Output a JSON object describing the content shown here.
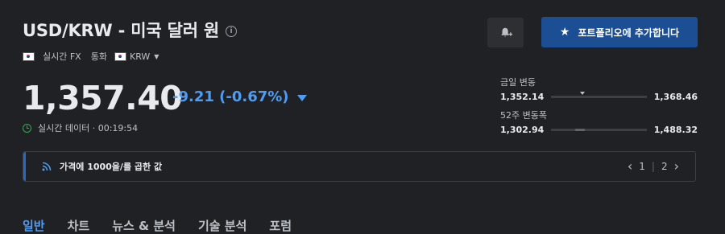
{
  "header": {
    "title": "USD/KRW - 미국 달러 원",
    "info_glyph": "i"
  },
  "meta": {
    "source": "실시간 FX",
    "currency_label": "통화",
    "currency_value": "KRW"
  },
  "quote": {
    "price": "1,357.40",
    "change": "-9.21 (-0.67%)",
    "direction": "down",
    "realtime_label": "실시간 데이터 · 00:19:54"
  },
  "actions": {
    "add_portfolio_label": "포트폴리오에 추가합니다",
    "star_glyph": "★"
  },
  "ranges": {
    "day": {
      "label": "금일 변동",
      "low": "1,352.14",
      "high": "1,368.46",
      "marker_fraction": 0.33
    },
    "week52": {
      "label": "52주 변동폭",
      "low": "1,302.94",
      "high": "1,488.32",
      "marker_fraction": 0.3
    }
  },
  "banner": {
    "text": "가격에 1000을/를 곱한 값",
    "page_current": "1",
    "page_total": "2",
    "prev_glyph": "‹",
    "next_glyph": "›"
  },
  "tabs": [
    {
      "label": "일반"
    },
    {
      "label": "차트"
    },
    {
      "label": "뉴스 & 분석"
    },
    {
      "label": "기술 분석"
    },
    {
      "label": "포럼"
    }
  ],
  "colors": {
    "background": "#202124",
    "accent_blue": "#4f9cf5",
    "button_blue": "#1b4e92",
    "realtime_green": "#34a853"
  },
  "icons": [
    "info-icon",
    "korea-flag-icon",
    "dropdown-caret-icon",
    "clock-icon",
    "bell-add-icon",
    "star-icon",
    "rss-icon",
    "chevron-left-icon",
    "chevron-right-icon",
    "down-triangle-icon"
  ]
}
